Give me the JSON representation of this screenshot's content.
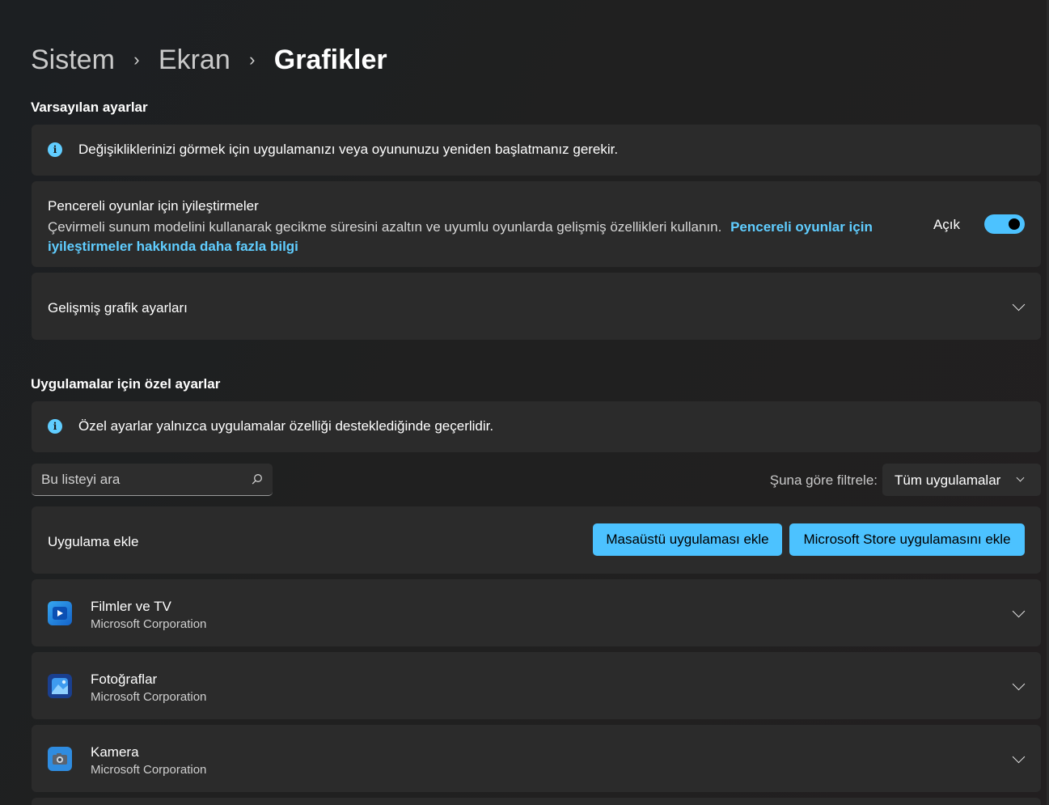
{
  "breadcrumb": {
    "items": [
      "Sistem",
      "Ekran"
    ],
    "current": "Grafikler",
    "separator": "›"
  },
  "default_settings": {
    "section_title": "Varsayılan ayarlar",
    "info_text": "Değişikliklerinizi görmek için uygulamanızı veya oyununuzu yeniden başlatmanız gerekir.",
    "windowed": {
      "title": "Pencereli oyunlar için iyileştirmeler",
      "description": "Çevirmeli sunum modelini kullanarak gecikme süresini azaltın ve uyumlu oyunlarda gelişmiş özellikleri kullanın.",
      "link_line1": "Pencereli oyunlar için",
      "link_line2": "iyileştirmeler hakkında daha fazla bilgi",
      "toggle_label": "Açık",
      "toggle_on": true
    },
    "advanced": {
      "label": "Gelişmiş grafik ayarları"
    }
  },
  "custom_settings": {
    "section_title": "Uygulamalar için özel ayarlar",
    "info_text": "Özel ayarlar yalnızca uygulamalar özelliği desteklediğinde geçerlidir."
  },
  "search": {
    "placeholder": "Bu listeyi ara"
  },
  "filter": {
    "label": "Şuna göre filtrele:",
    "selected": "Tüm uygulamalar"
  },
  "add_app": {
    "label": "Uygulama ekle",
    "desktop_button": "Masaüstü uygulaması ekle",
    "store_button": "Microsoft Store uygulamasını ekle"
  },
  "apps": [
    {
      "name": "Filmler ve TV",
      "publisher": "Microsoft Corporation",
      "icon": "movies-tv-icon"
    },
    {
      "name": "Fotoğraflar",
      "publisher": "Microsoft Corporation",
      "icon": "photos-icon"
    },
    {
      "name": "Kamera",
      "publisher": "Microsoft Corporation",
      "icon": "camera-icon"
    }
  ],
  "colors": {
    "accent": "#4cc2ff",
    "link": "#60cdff",
    "card": "#2b2b2b",
    "background": "#202020"
  }
}
